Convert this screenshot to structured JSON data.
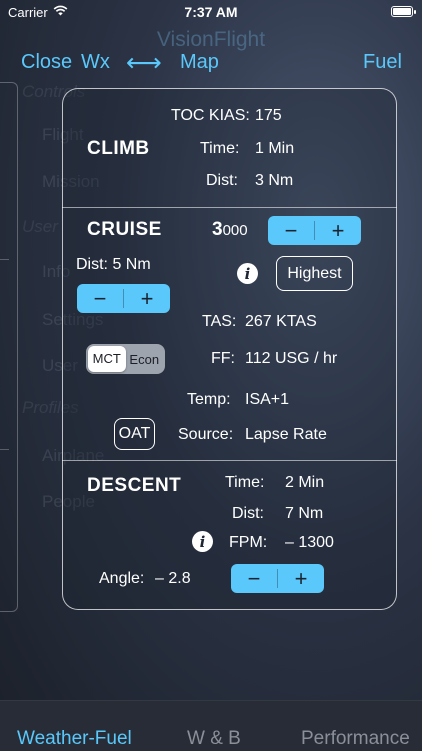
{
  "status_bar": {
    "carrier": "Carrier",
    "time": "7:37 AM"
  },
  "background": {
    "app_title": "VisionFlight",
    "menu": [
      {
        "label": "Controls",
        "top": 0
      },
      {
        "label": "Flight",
        "top": 0
      },
      {
        "label": "Mission",
        "top": 0
      },
      {
        "label": "User",
        "top": 0
      },
      {
        "label": "Info",
        "top": 0
      },
      {
        "label": "Settings",
        "top": 0
      },
      {
        "label": "User",
        "top": 0
      },
      {
        "label": "Profiles",
        "top": 0
      },
      {
        "label": "Airplane",
        "top": 0
      },
      {
        "label": "People",
        "top": 0
      }
    ]
  },
  "nav": {
    "close": "Close",
    "wx": "Wx",
    "map": "Map",
    "fuel": "Fuel"
  },
  "climb": {
    "title": "CLIMB",
    "toc_kias_label": "TOC KIAS:",
    "toc_kias_value": "175",
    "time_label": "Time:",
    "time_value": "1 Min",
    "dist_label": "Dist:",
    "dist_value": "3 Nm"
  },
  "cruise": {
    "title": "CRUISE",
    "altitude_major": "3",
    "altitude_minor": "000",
    "dist_text": "Dist: 5 Nm",
    "highest_label": "Highest",
    "tas_label": "TAS:",
    "tas_value": "267  KTAS",
    "power_options": [
      "MCT",
      "Econ"
    ],
    "power_selected": "MCT",
    "ff_label": "FF:",
    "ff_value": "112  USG / hr",
    "temp_label": "Temp:",
    "temp_value": "ISA+1",
    "oat_label": "OAT",
    "source_label": "Source:",
    "source_value": "Lapse Rate"
  },
  "descent": {
    "title": "DESCENT",
    "time_label": "Time:",
    "time_value": "2  Min",
    "dist_label": "Dist:",
    "dist_value": "7  Nm",
    "fpm_label": "FPM:",
    "fpm_value": "– 1300",
    "angle_label": "Angle:",
    "angle_value": "– 2.8"
  },
  "stepper": {
    "minus": "−",
    "plus": "+"
  },
  "tabs": [
    {
      "label": "Weather-Fuel",
      "active": true
    },
    {
      "label": "W & B",
      "active": false
    },
    {
      "label": "Performance",
      "active": false
    }
  ],
  "colors": {
    "accent": "#5ac8fa",
    "background": "#2a3140"
  }
}
